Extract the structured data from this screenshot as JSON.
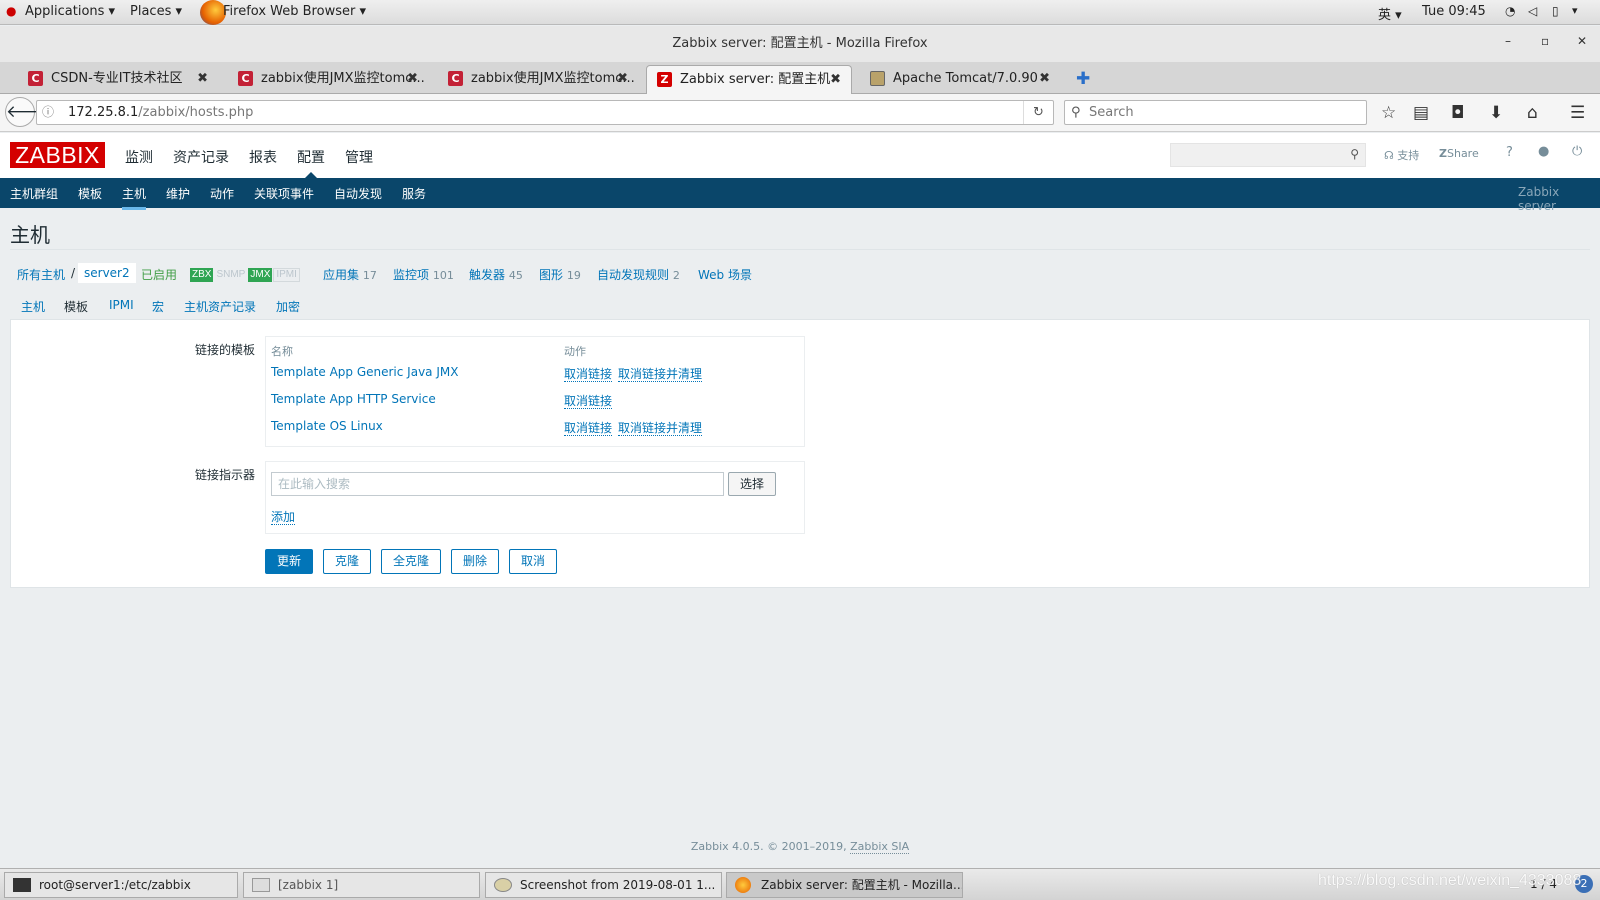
{
  "system": {
    "applications": "Applications",
    "places": "Places",
    "browser": "Firefox Web Browser",
    "lang": "英",
    "clock": "Tue 09:45"
  },
  "window": {
    "title": "Zabbix server: 配置主机 - Mozilla Firefox"
  },
  "tabs": [
    {
      "label": "CSDN-专业IT技术社区",
      "icon": "C"
    },
    {
      "label": "zabbix使用JMX监控tomc...",
      "icon": "C"
    },
    {
      "label": "zabbix使用JMX监控tomc...",
      "icon": "C"
    },
    {
      "label": "Zabbix server: 配置主机",
      "icon": "Z"
    },
    {
      "label": "Apache Tomcat/7.0.90",
      "icon": ""
    }
  ],
  "nav": {
    "url_host": "172.25.8.1",
    "url_path": "/zabbix/hosts.php",
    "search_placeholder": "Search"
  },
  "zabbix": {
    "logo": "ZABBIX",
    "menu": [
      "监测",
      "资产记录",
      "报表",
      "配置",
      "管理"
    ],
    "support": "支持",
    "share": "Share",
    "help": "?",
    "submenu": [
      "主机群组",
      "模板",
      "主机",
      "维护",
      "动作",
      "关联项事件",
      "自动发现",
      "服务"
    ],
    "server_name": "Zabbix server",
    "page_title": "主机",
    "breadcrumb": {
      "all_hosts": "所有主机",
      "sep": "/",
      "host": "server2",
      "status": "已启用",
      "badges": [
        "ZBX",
        "SNMP",
        "JMX",
        "IPMI"
      ],
      "apps": "应用集",
      "apps_n": "17",
      "items": "监控项",
      "items_n": "101",
      "triggers": "触发器",
      "triggers_n": "45",
      "graphs": "图形",
      "graphs_n": "19",
      "discovery": "自动发现规则",
      "discovery_n": "2",
      "web": "Web 场景"
    },
    "form_tabs": [
      "主机",
      "模板",
      "IPMI",
      "宏",
      "主机资产记录",
      "加密"
    ],
    "linked_label": "链接的模板",
    "col_name": "名称",
    "col_action": "动作",
    "templates": [
      {
        "name": "Template App Generic Java JMX",
        "unlink": "取消链接",
        "unlink_clear": "取消链接并清理"
      },
      {
        "name": "Template App HTTP Service",
        "unlink": "取消链接",
        "unlink_clear": ""
      },
      {
        "name": "Template OS Linux",
        "unlink": "取消链接",
        "unlink_clear": "取消链接并清理"
      }
    ],
    "link_indicator_label": "链接指示器",
    "search_placeholder": "在此输入搜索",
    "select_btn": "选择",
    "add_link": "添加",
    "buttons": {
      "update": "更新",
      "clone": "克隆",
      "full_clone": "全克隆",
      "delete": "删除",
      "cancel": "取消"
    },
    "footer_text": "Zabbix 4.0.5. © 2001–2019,",
    "footer_link": "Zabbix SIA"
  },
  "taskbar": {
    "items": [
      "root@server1:/etc/zabbix",
      "[zabbix 1]",
      "Screenshot from 2019-08-01 1...",
      "Zabbix server: 配置主机 - Mozilla..."
    ],
    "pager": "1 / 4",
    "watermark": "https://blog.csdn.net/weixin_4333088"
  },
  "colors": {
    "zabbix_red": "#d40000",
    "nav_blue": "#0a466a",
    "link_blue": "#0275b8",
    "zbx_green": "#59db8f",
    "jmx_green": "#2fa553"
  }
}
